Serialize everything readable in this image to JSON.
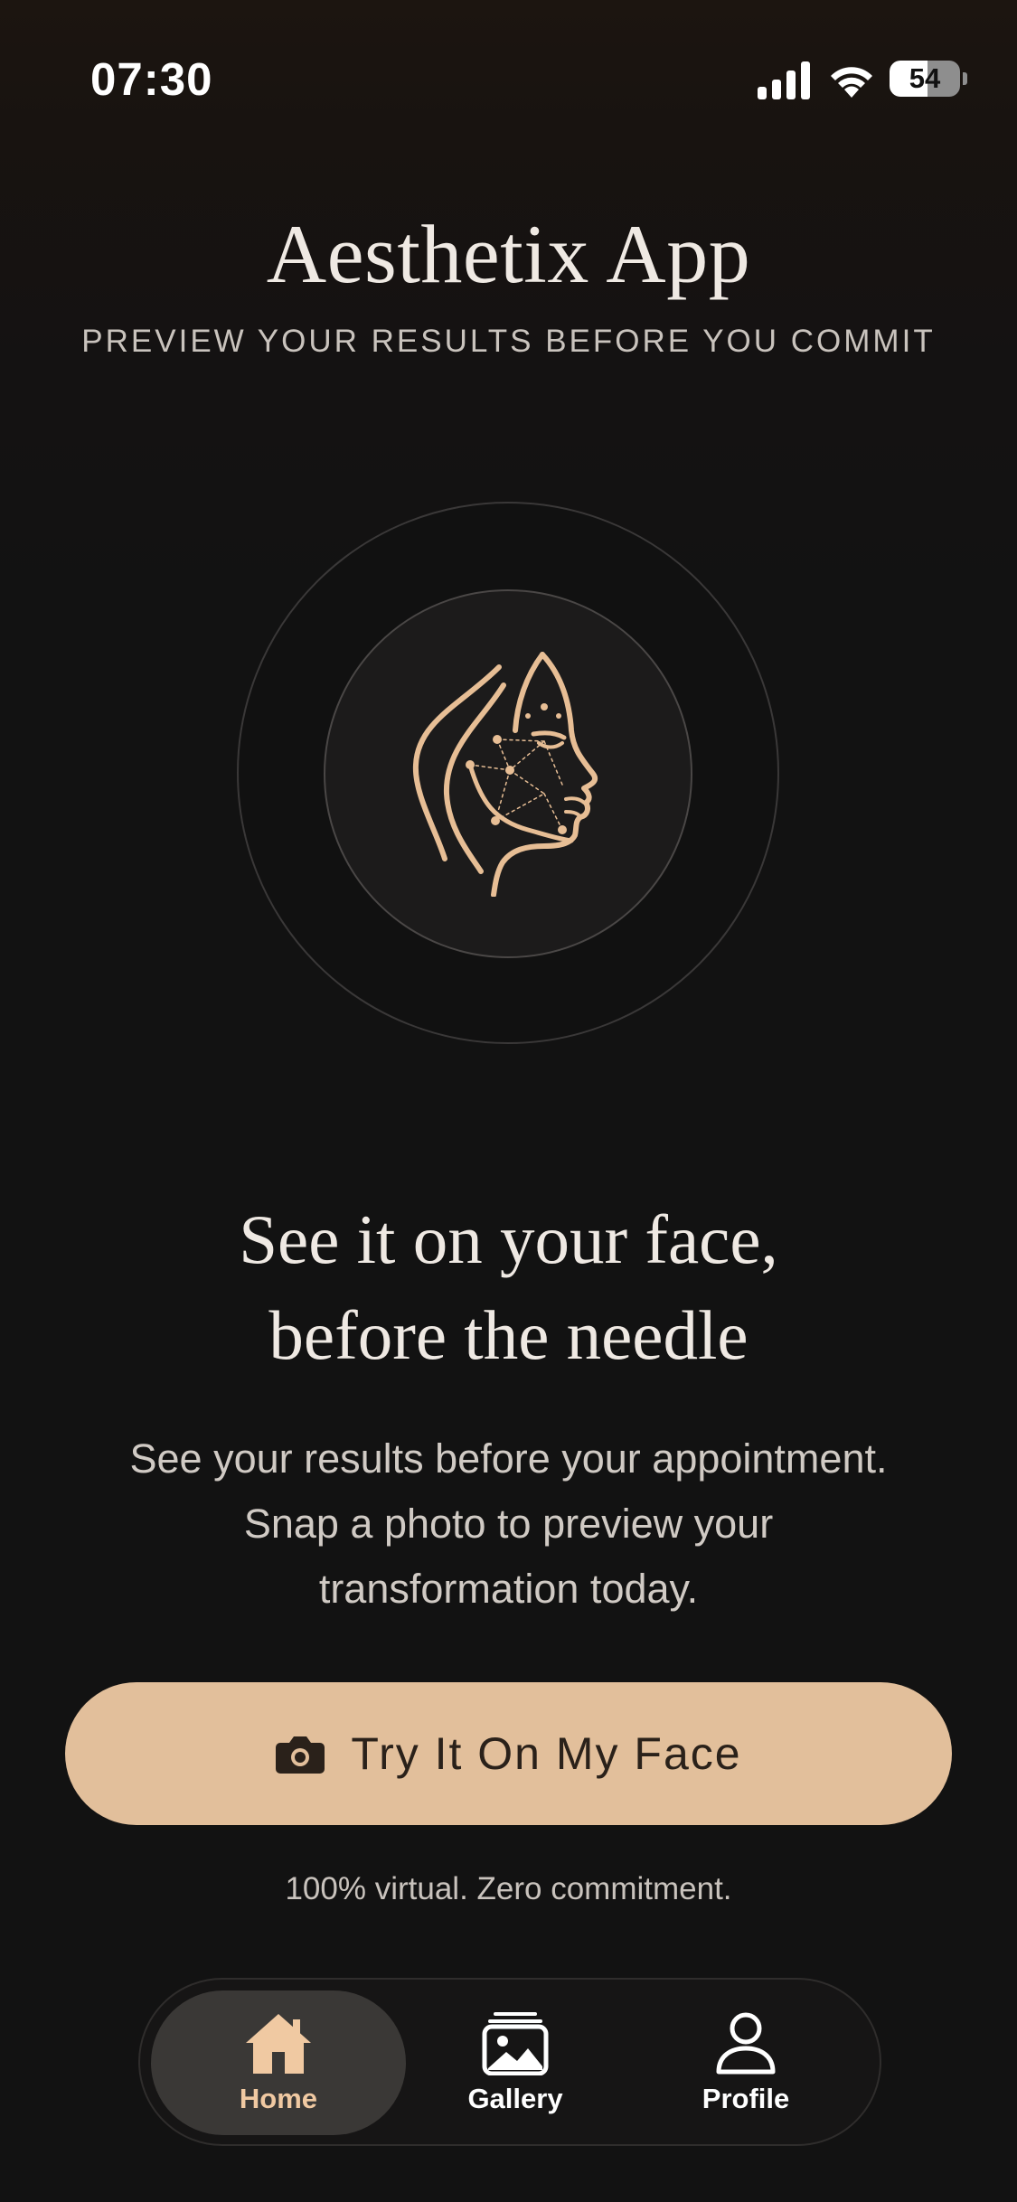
{
  "status_bar": {
    "time": "07:30",
    "battery_level": "54",
    "battery_fraction": 0.54
  },
  "header": {
    "title": "Aesthetix App",
    "subtitle": "PREVIEW YOUR RESULTS BEFORE YOU COMMIT"
  },
  "hero": {
    "icon": "face-profile-icon"
  },
  "headline": {
    "line1": "See it on your face,",
    "line2": "before the needle"
  },
  "description": {
    "line1": "See your results before your appointment.",
    "line2": "Snap a photo to preview your",
    "line3": "transformation today."
  },
  "cta": {
    "label": "Try It On My Face",
    "icon": "camera-icon"
  },
  "disclaimer": "100% virtual. Zero commitment.",
  "tab_bar": {
    "items": [
      {
        "label": "Home",
        "icon": "home-icon",
        "active": true
      },
      {
        "label": "Gallery",
        "icon": "gallery-icon",
        "active": false
      },
      {
        "label": "Profile",
        "icon": "profile-icon",
        "active": false
      }
    ]
  },
  "colors": {
    "accent": "#e2bf9b",
    "accent_text": "#f0c9a2",
    "background": "#121212"
  }
}
